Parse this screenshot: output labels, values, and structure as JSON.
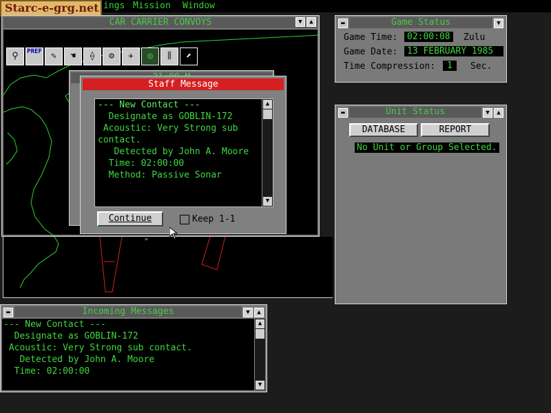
{
  "menubar": {
    "watermark": "Starc-e-grg.net",
    "items": [
      "ings",
      "Mission",
      "Window"
    ]
  },
  "map_window": {
    "title": "CAR CARRIER CONVOYS",
    "toolbar_icons": [
      "magnifier-icon",
      "preferences-icon",
      "brush-icon",
      "hand-icon",
      "compass-icon",
      "gear-icon",
      "aircraft-icon",
      "radar-icon",
      "bars-icon",
      "waypoint-icon"
    ],
    "pref_label": "PREF",
    "bg_window_title": "21:00 M"
  },
  "staff_message": {
    "title": "Staff Message",
    "lines": [
      "--- New Contact ---",
      "  Designate as GOBLIN-172",
      " Acoustic: Very Strong sub",
      "contact.",
      "   Detected by John A. Moore",
      "  Time: 02:00:00",
      "  Method: Passive Sonar"
    ],
    "continue_label": "Continue",
    "keep_label": "Keep 1-1"
  },
  "game_status": {
    "title": "Game Status",
    "time_label": "Game Time:",
    "time_value": "02:00:08",
    "zone": "Zulu",
    "date_label": "Game Date:",
    "date_value": "13 FEBRUARY 1985",
    "compression_label": "Time Compression:",
    "compression_value": "1",
    "compression_unit": "Sec."
  },
  "unit_status": {
    "title": "Unit Status",
    "database_label": "DATABASE",
    "report_label": "REPORT",
    "message": "No Unit or Group Selected."
  },
  "incoming": {
    "title": "Incoming Messages",
    "lines": [
      "--- New Contact ---",
      "  Designate as GOBLIN-172",
      " Acoustic: Very Strong sub contact.",
      "   Detected by John A. Moore",
      "  Time: 02:00:00"
    ]
  },
  "colors": {
    "accent_green": "#3fd93f",
    "title_red": "#d42020",
    "window_gray": "#7c7c7c"
  }
}
